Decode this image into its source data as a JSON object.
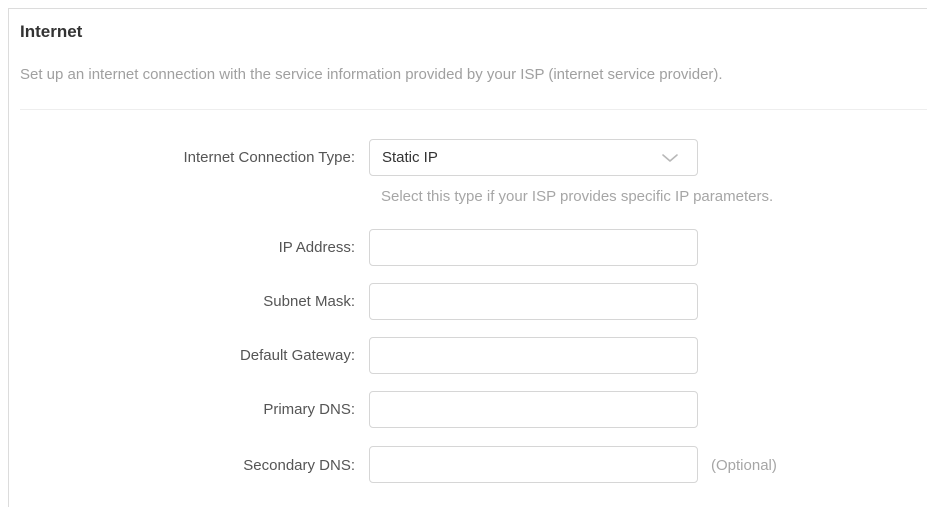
{
  "section": {
    "title": "Internet",
    "description": "Set up an internet connection with the service information provided by your ISP (internet service provider)."
  },
  "connection_type": {
    "label": "Internet Connection Type:",
    "selected": "Static IP",
    "hint": "Select this type if your ISP provides specific IP parameters.",
    "icon": "chevron-down-icon"
  },
  "fields": {
    "ip_address": {
      "label": "IP Address:",
      "value": ""
    },
    "subnet_mask": {
      "label": "Subnet Mask:",
      "value": ""
    },
    "default_gateway": {
      "label": "Default Gateway:",
      "value": ""
    },
    "primary_dns": {
      "label": "Primary DNS:",
      "value": ""
    },
    "secondary_dns": {
      "label": "Secondary DNS:",
      "value": "",
      "note": "(Optional)"
    }
  },
  "colors": {
    "title_text": "#333333",
    "label_text": "#555555",
    "muted_text": "#a6a6a6",
    "input_border": "#d6d6d6"
  }
}
